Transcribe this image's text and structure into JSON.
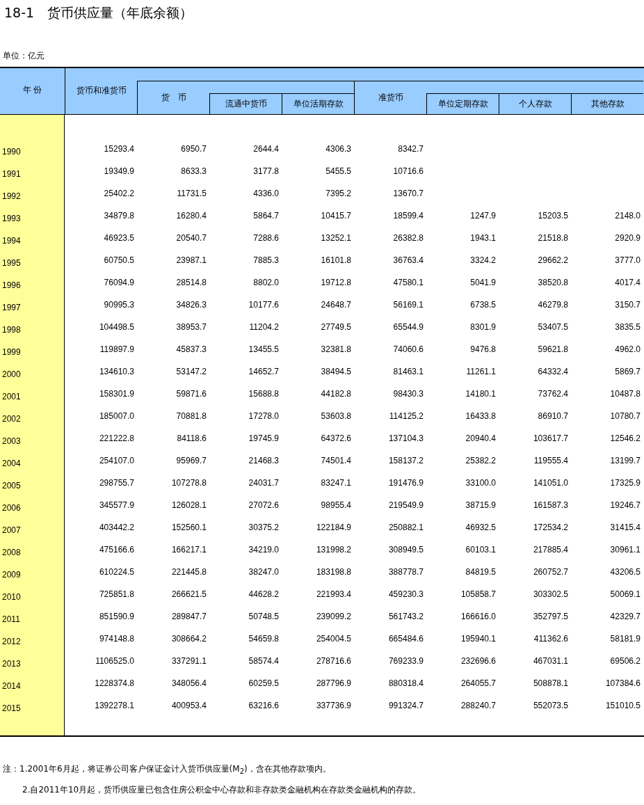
{
  "title": "18-1　货币供应量（年底余额）",
  "unit": "单位：亿元",
  "header": {
    "year": "年 份",
    "total": "货币和准货币",
    "money": "货　币",
    "money_sub": [
      "流通中货币",
      "单位活期存款"
    ],
    "quasi": "准货币",
    "quasi_sub": [
      "单位定期存款",
      "个人存款",
      "其他存款"
    ]
  },
  "rows": [
    {
      "year": "1990",
      "values": [
        "15293.4",
        "6950.7",
        "2644.4",
        "4306.3",
        "8342.7"
      ]
    },
    {
      "year": "1991",
      "values": [
        "19349.9",
        "8633.3",
        "3177.8",
        "5455.5",
        "10716.6"
      ]
    },
    {
      "year": "1992",
      "values": [
        "25402.2",
        "11731.5",
        "4336.0",
        "7395.2",
        "13670.7"
      ]
    },
    {
      "year": "1993",
      "values": [
        "34879.8",
        "16280.4",
        "5864.7",
        "10415.7",
        "18599.4",
        "1247.9",
        "15203.5",
        "2148.0"
      ]
    },
    {
      "year": "1994",
      "values": [
        "46923.5",
        "20540.7",
        "7288.6",
        "13252.1",
        "26382.8",
        "1943.1",
        "21518.8",
        "2920.9"
      ]
    },
    {
      "year": "1995",
      "values": [
        "60750.5",
        "23987.1",
        "7885.3",
        "16101.8",
        "36763.4",
        "3324.2",
        "29662.2",
        "3777.0"
      ]
    },
    {
      "year": "1996",
      "values": [
        "76094.9",
        "28514.8",
        "8802.0",
        "19712.8",
        "47580.1",
        "5041.9",
        "38520.8",
        "4017.4"
      ]
    },
    {
      "year": "1997",
      "values": [
        "90995.3",
        "34826.3",
        "10177.6",
        "24648.7",
        "56169.1",
        "6738.5",
        "46279.8",
        "3150.7"
      ]
    },
    {
      "year": "1998",
      "values": [
        "104498.5",
        "38953.7",
        "11204.2",
        "27749.5",
        "65544.9",
        "8301.9",
        "53407.5",
        "3835.5"
      ]
    },
    {
      "year": "1999",
      "values": [
        "119897.9",
        "45837.3",
        "13455.5",
        "32381.8",
        "74060.6",
        "9476.8",
        "59621.8",
        "4962.0"
      ]
    },
    {
      "year": "2000",
      "values": [
        "134610.3",
        "53147.2",
        "14652.7",
        "38494.5",
        "81463.1",
        "11261.1",
        "64332.4",
        "5869.7"
      ]
    },
    {
      "year": "2001",
      "values": [
        "158301.9",
        "59871.6",
        "15688.8",
        "44182.8",
        "98430.3",
        "14180.1",
        "73762.4",
        "10487.8"
      ]
    },
    {
      "year": "2002",
      "values": [
        "185007.0",
        "70881.8",
        "17278.0",
        "53603.8",
        "114125.2",
        "16433.8",
        "86910.7",
        "10780.7"
      ]
    },
    {
      "year": "2003",
      "values": [
        "221222.8",
        "84118.6",
        "19745.9",
        "64372.6",
        "137104.3",
        "20940.4",
        "103617.7",
        "12546.2"
      ]
    },
    {
      "year": "2004",
      "values": [
        "254107.0",
        "95969.7",
        "21468.3",
        "74501.4",
        "158137.2",
        "25382.2",
        "119555.4",
        "13199.7"
      ]
    },
    {
      "year": "2005",
      "values": [
        "298755.7",
        "107278.8",
        "24031.7",
        "83247.1",
        "191476.9",
        "33100.0",
        "141051.0",
        "17325.9"
      ]
    },
    {
      "year": "2006",
      "values": [
        "345577.9",
        "126028.1",
        "27072.6",
        "98955.4",
        "219549.9",
        "38715.9",
        "161587.3",
        "19246.7"
      ]
    },
    {
      "year": "2007",
      "values": [
        "403442.2",
        "152560.1",
        "30375.2",
        "122184.9",
        "250882.1",
        "46932.5",
        "172534.2",
        "31415.4"
      ]
    },
    {
      "year": "2008",
      "values": [
        "475166.6",
        "166217.1",
        "34219.0",
        "131998.2",
        "308949.5",
        "60103.1",
        "217885.4",
        "30961.1"
      ]
    },
    {
      "year": "2009",
      "values": [
        "610224.5",
        "221445.8",
        "38247.0",
        "183198.8",
        "388778.7",
        "84819.5",
        "260752.7",
        "43206.5"
      ]
    },
    {
      "year": "2010",
      "values": [
        "725851.8",
        "266621.5",
        "44628.2",
        "221993.4",
        "459230.3",
        "105858.7",
        "303302.5",
        "50069.1"
      ]
    },
    {
      "year": "2011",
      "values": [
        "851590.9",
        "289847.7",
        "50748.5",
        "239099.2",
        "561743.2",
        "166616.0",
        "352797.5",
        "42329.7"
      ]
    },
    {
      "year": "2012",
      "values": [
        "974148.8",
        "308664.2",
        "54659.8",
        "254004.5",
        "665484.6",
        "195940.1",
        "411362.6",
        "58181.9"
      ]
    },
    {
      "year": "2013",
      "values": [
        "1106525.0",
        "337291.1",
        "58574.4",
        "278716.6",
        "769233.9",
        "232696.6",
        "467031.1",
        "69506.2"
      ]
    },
    {
      "year": "2014",
      "values": [
        "1228374.8",
        "348056.4",
        "60259.5",
        "287796.9",
        "880318.4",
        "264055.7",
        "508878.1",
        "107384.6"
      ]
    },
    {
      "year": "2015",
      "values": [
        "1392278.1",
        "400953.4",
        "63216.6",
        "337736.9",
        "991324.7",
        "288240.7",
        "552073.5",
        "151010.5"
      ]
    }
  ],
  "notes": [
    "注：1.2001年6月起，将证券公司客户保证金计入货币供应量(M$_{2}$)，含在其他存款项内。",
    "2.自2011年10月起，货币供应量已包含住房公积金中心存款和非存款类金融机构在存款类金融机构的存款。"
  ]
}
